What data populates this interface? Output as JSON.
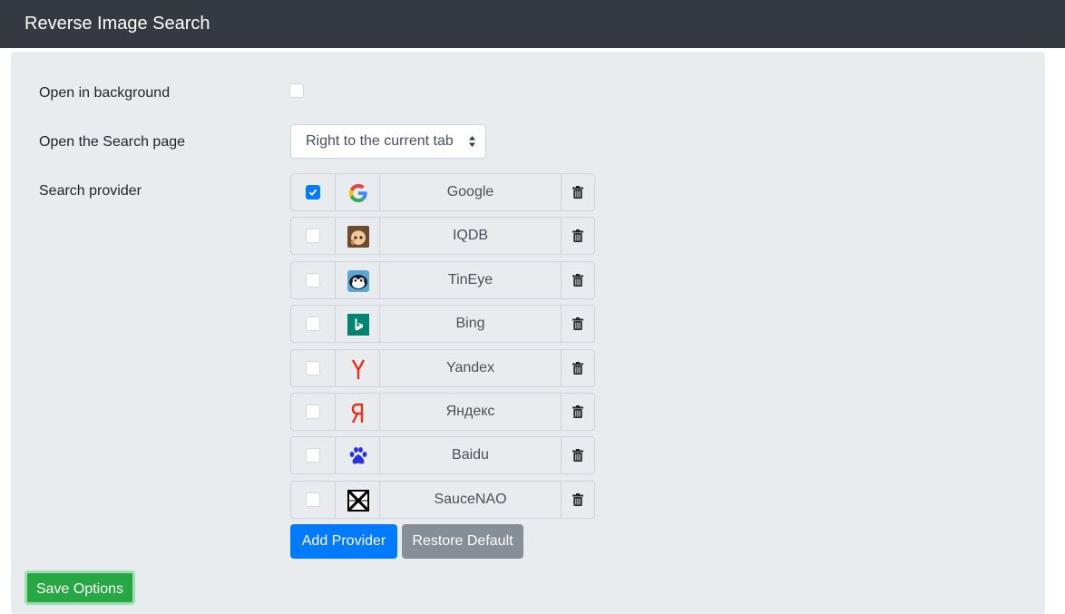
{
  "header": {
    "title": "Reverse Image Search"
  },
  "options": {
    "open_background_label": "Open in background",
    "open_background_checked": false,
    "open_search_page_label": "Open the Search page",
    "open_search_page_value": "Right to the current tab",
    "search_provider_label": "Search provider"
  },
  "providers": [
    {
      "name": "Google",
      "enabled": true,
      "icon": "google-icon"
    },
    {
      "name": "IQDB",
      "enabled": false,
      "icon": "iqdb-icon"
    },
    {
      "name": "TinEye",
      "enabled": false,
      "icon": "tineye-icon"
    },
    {
      "name": "Bing",
      "enabled": false,
      "icon": "bing-icon"
    },
    {
      "name": "Yandex",
      "enabled": false,
      "icon": "yandex-icon"
    },
    {
      "name": "Яндекс",
      "enabled": false,
      "icon": "yandex-ru-icon"
    },
    {
      "name": "Baidu",
      "enabled": false,
      "icon": "baidu-icon"
    },
    {
      "name": "SauceNAO",
      "enabled": false,
      "icon": "saucenao-icon"
    }
  ],
  "buttons": {
    "add_provider": "Add Provider",
    "restore_default": "Restore Default",
    "save_options": "Save Options"
  },
  "colors": {
    "navbar": "#343a40",
    "panel": "#e9ecef",
    "primary": "#007bff",
    "secondary": "#868e96",
    "success": "#28a745"
  }
}
